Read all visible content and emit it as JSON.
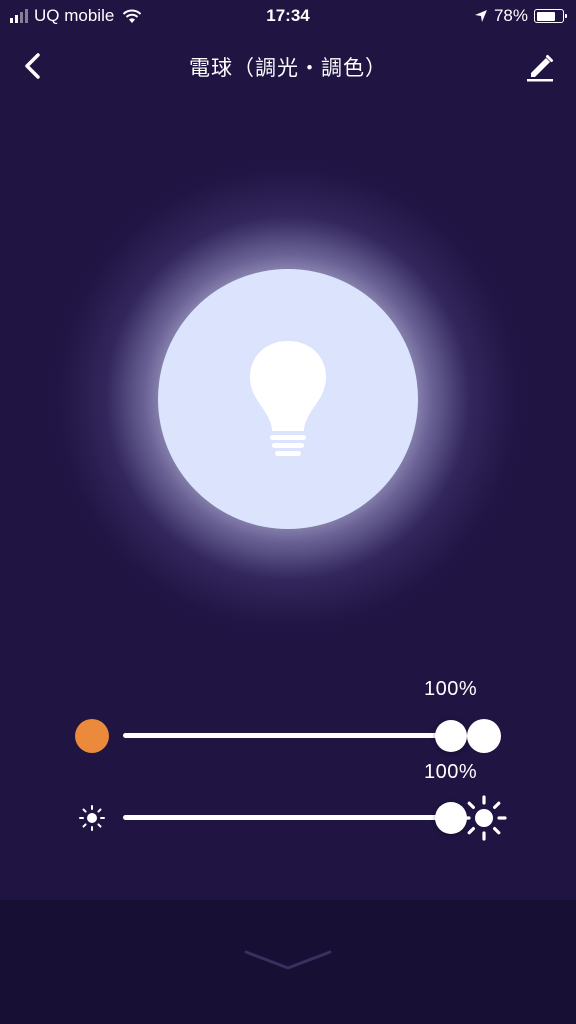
{
  "status_bar": {
    "carrier": "UQ mobile",
    "time": "17:34",
    "battery_percent": "78%",
    "battery_level": 0.78
  },
  "nav": {
    "title": "電球（調光・調色）"
  },
  "icons": {
    "back": "chevron-left-icon",
    "edit": "pencil-icon",
    "bulb": "light-bulb-icon",
    "warm": "warm-color-dot",
    "cool": "cool-color-dot",
    "brightness_low": "sun-small-icon",
    "brightness_high": "sun-large-icon",
    "expand": "chevron-down-icon"
  },
  "colors": {
    "background": "#1f1442",
    "bulb_fill": "#dce4fd",
    "warm": "#ea8a3a",
    "cool": "#ffffff",
    "bottom_panel": "#180f35"
  },
  "color_temperature": {
    "label": "100%",
    "value": 1.0
  },
  "brightness": {
    "label": "100%",
    "value": 1.0
  }
}
